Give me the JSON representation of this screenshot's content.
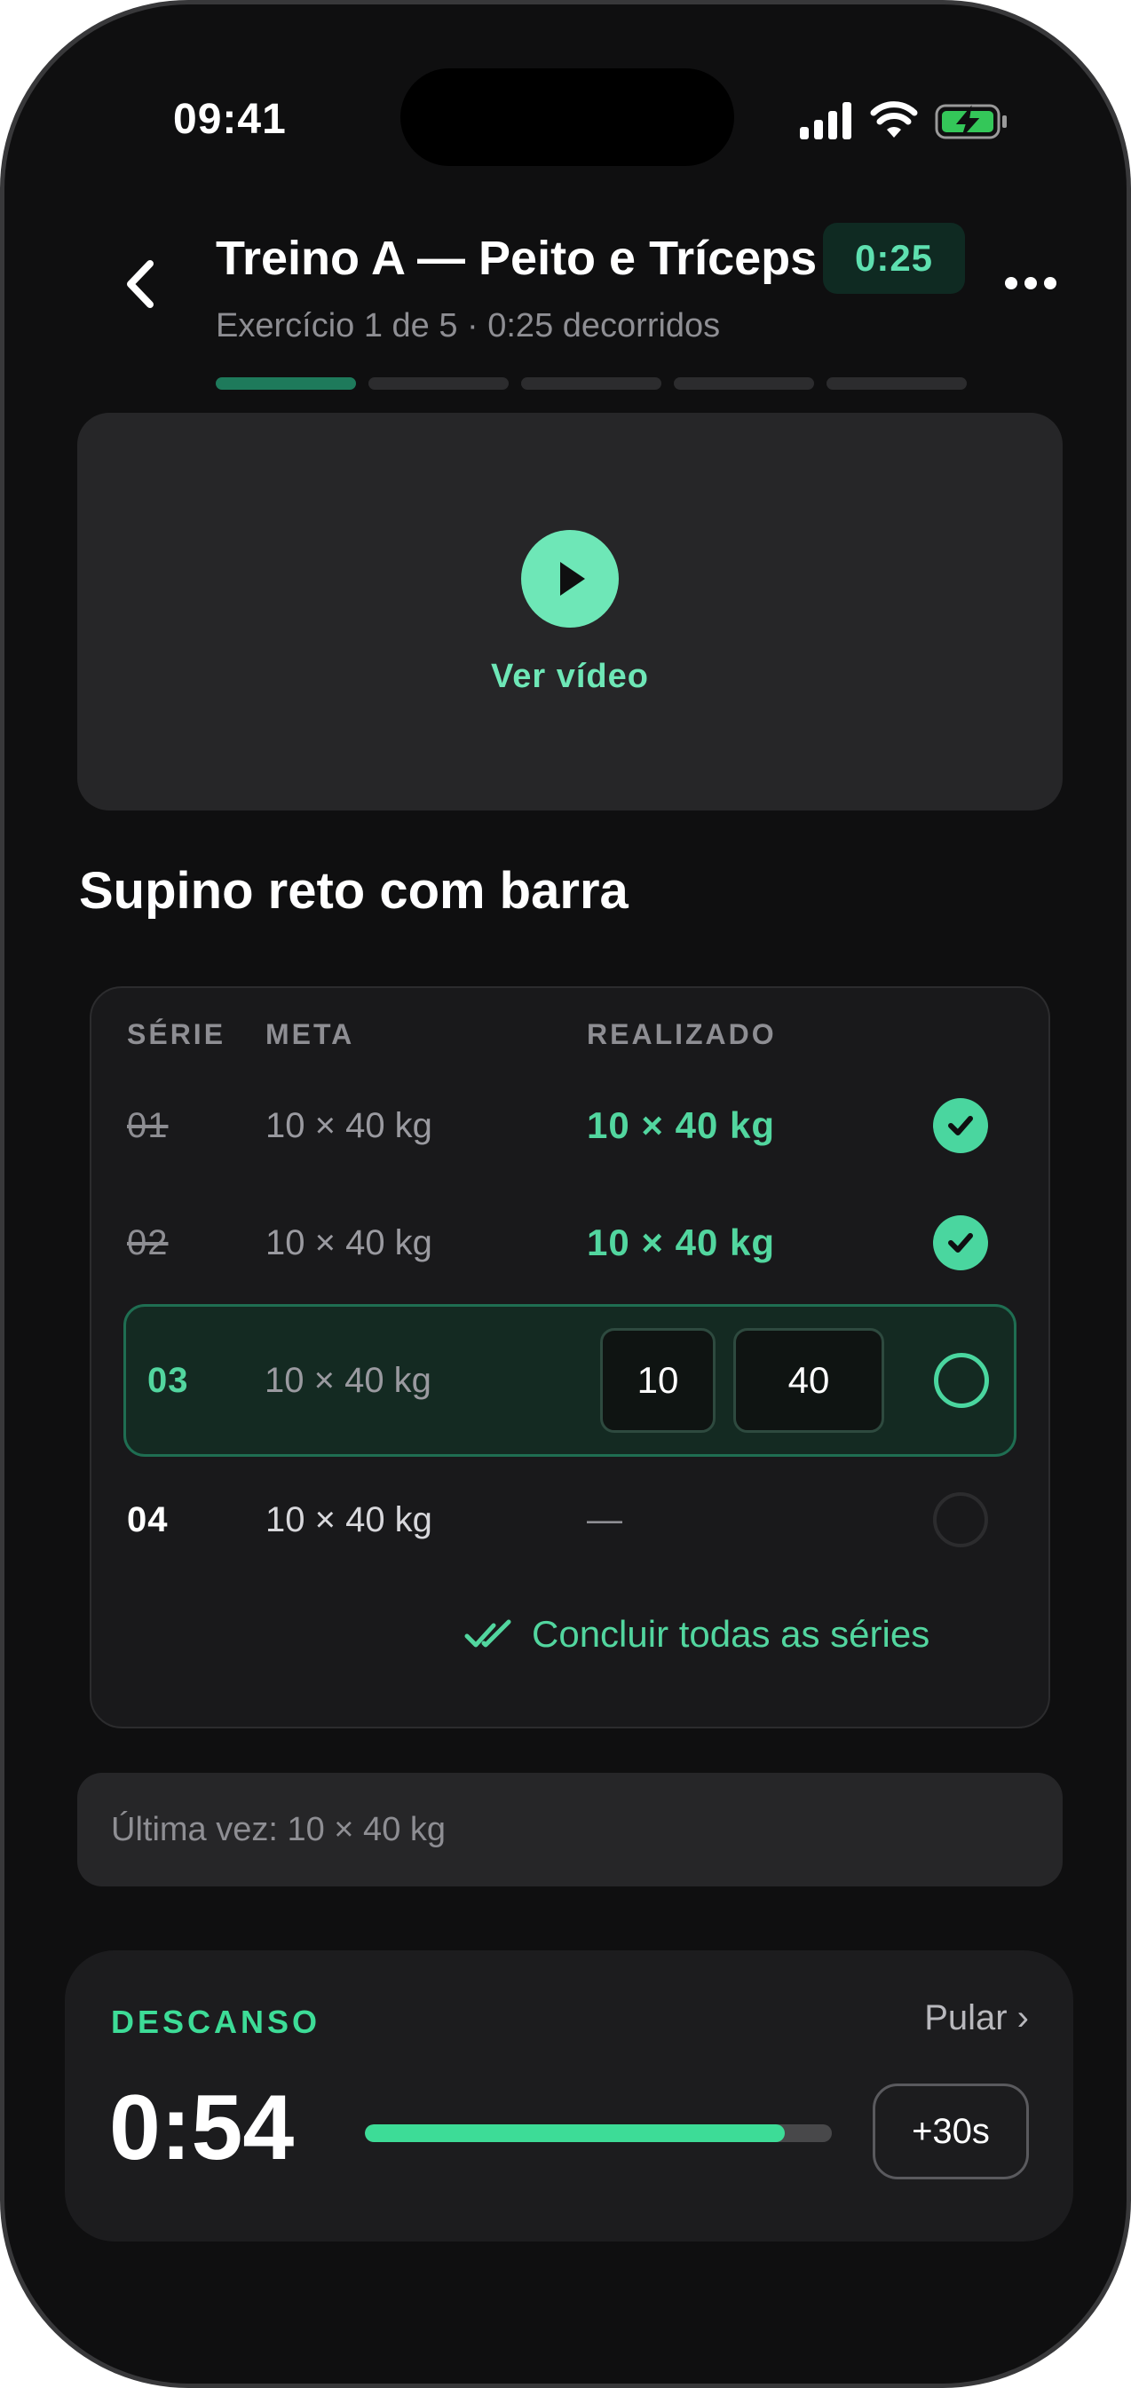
{
  "status_bar": {
    "time": "09:41",
    "icons": [
      "signal-icon",
      "wifi-icon",
      "battery-charging-icon"
    ]
  },
  "header": {
    "title": "Treino A — Peito e Tríceps",
    "timer": "0:25",
    "subtitle": "Exercício 1 de 5 · 0:25 decorridos",
    "progress": {
      "total": 5,
      "completed": 1
    }
  },
  "video": {
    "label": "Ver vídeo"
  },
  "exercise": {
    "name": "Supino reto com barra"
  },
  "sets_table": {
    "headers": {
      "set": "SÉRIE",
      "target": "META",
      "done": "REALIZADO"
    },
    "rows": [
      {
        "num": "01",
        "target": "10 × 40 kg",
        "done": "10 × 40 kg",
        "state": "done"
      },
      {
        "num": "02",
        "target": "10 × 40 kg",
        "done": "10 × 40 kg",
        "state": "done"
      },
      {
        "num": "03",
        "target": "10 × 40 kg",
        "reps": "10",
        "weight": "40",
        "state": "current"
      },
      {
        "num": "04",
        "target": "10 × 40 kg",
        "done": "—",
        "state": "pending"
      }
    ],
    "complete_all": "Concluir todas as séries"
  },
  "last_time": "Última vez: 10 × 40 kg",
  "rest": {
    "label": "DESCANSO",
    "skip": "Pular ›",
    "time": "0:54",
    "progress_fraction": 0.9,
    "add": "+30s"
  },
  "colors": {
    "accent": "#4ad69f",
    "background": "#0f0f10",
    "card": "#262628"
  }
}
